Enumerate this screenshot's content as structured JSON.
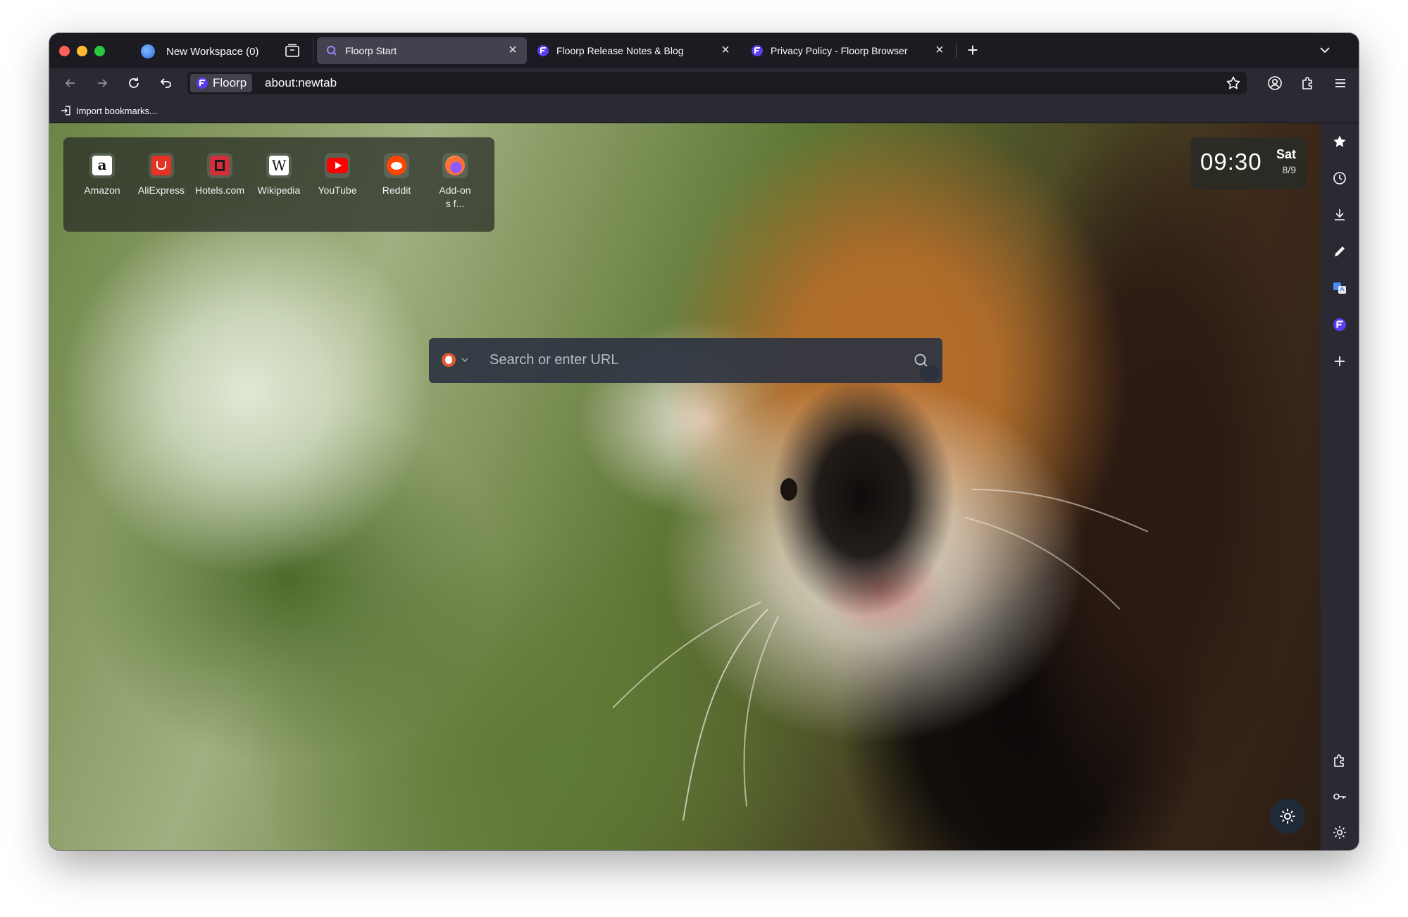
{
  "workspace": {
    "label": "New Workspace (0)"
  },
  "tabs": [
    {
      "title": "Floorp Start",
      "active": true
    },
    {
      "title": "Floorp Release Notes & Blog",
      "active": false
    },
    {
      "title": "Privacy Policy - Floorp Browser",
      "active": false
    }
  ],
  "navbar": {
    "identity_label": "Floorp",
    "url": "about:newtab"
  },
  "bookmarks_toolbar": {
    "import_label": "Import bookmarks..."
  },
  "shortcuts": [
    {
      "label": "Amazon",
      "icon": "amazon-icon"
    },
    {
      "label": "AliExpress",
      "icon": "aliexpress-icon"
    },
    {
      "label": "Hotels.com",
      "icon": "hotels-icon"
    },
    {
      "label": "Wikipedia",
      "icon": "wikipedia-icon"
    },
    {
      "label": "YouTube",
      "icon": "youtube-icon"
    },
    {
      "label": "Reddit",
      "icon": "reddit-icon"
    },
    {
      "label": "Add-ons f...",
      "icon": "firefox-icon"
    }
  ],
  "clock": {
    "time": "09:30",
    "day": "Sat",
    "date": "8/9"
  },
  "search": {
    "placeholder": "Search or enter URL",
    "engine_icon": "duckduckgo-icon"
  },
  "sidebar_icons": [
    "star-icon",
    "history-icon",
    "download-icon",
    "pen-icon",
    "translate-icon",
    "floorp-icon",
    "plus-icon",
    "extensions-icon",
    "key-icon",
    "gear-icon"
  ],
  "colors": {
    "accent": "#7b61ff",
    "chrome_dark": "#1c1b22",
    "toolbar": "#2b2a33",
    "tab_active": "#42414d"
  }
}
